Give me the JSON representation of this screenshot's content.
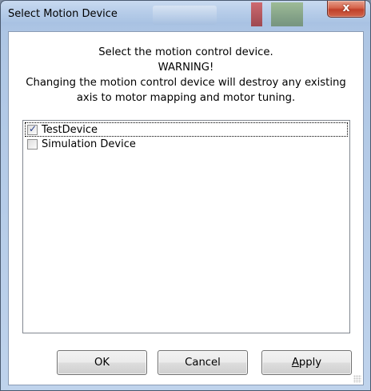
{
  "window": {
    "title": "Select Motion Device",
    "close_glyph": "x"
  },
  "message": {
    "line1": "Select the motion control device.",
    "line2": "WARNING!",
    "line3": "Changing the motion control device will destroy any existing",
    "line4": "axis to motor mapping and motor tuning."
  },
  "devices": [
    {
      "label": "TestDevice",
      "checked": true,
      "check_glyph": "✓"
    },
    {
      "label": "Simulation Device",
      "checked": false,
      "check_glyph": ""
    }
  ],
  "buttons": {
    "ok": "OK",
    "cancel": "Cancel",
    "apply_accel": "A",
    "apply_rest": "pply"
  },
  "icons": {
    "close": "close-icon",
    "checkmark": "checkmark-icon",
    "resize_grip": "resize-grip-icon"
  },
  "colors": {
    "title_bar": "#b7cde9",
    "close_button": "#c0402a",
    "client_bg": "#ffffff",
    "check_mark": "#2a3f8a"
  }
}
